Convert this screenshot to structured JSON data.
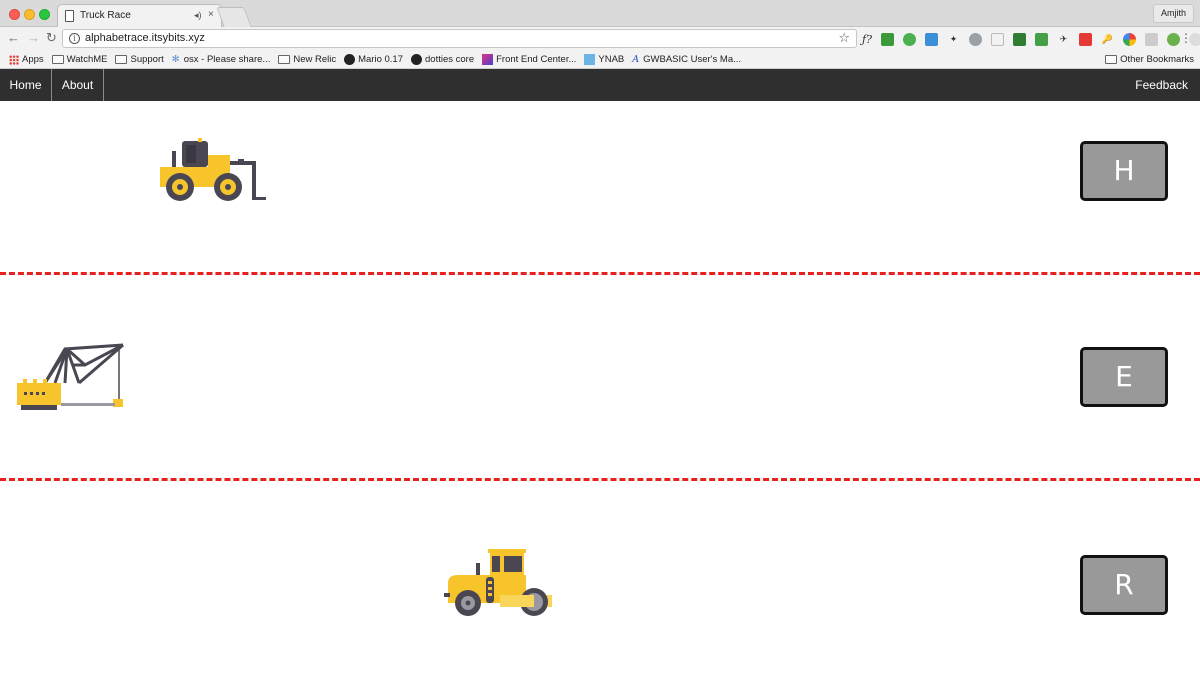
{
  "browser": {
    "tab_title": "Truck Race",
    "tab_close": "×",
    "tab_audio": "◂)",
    "profile_name": "Amjith",
    "url": "alphabetrace.itsybits.xyz",
    "back": "←",
    "forward": "→",
    "reload": "↻",
    "star": "☆",
    "menu": "⋮",
    "ext_text": "ƒ?",
    "bookmarks": [
      {
        "label": "Apps",
        "icon": "apps-grid-icon"
      },
      {
        "label": "WatchME",
        "icon": "folder-icon"
      },
      {
        "label": "Support",
        "icon": "folder-icon"
      },
      {
        "label": "osx - Please share...",
        "icon": "bookmark-icon"
      },
      {
        "label": "New Relic",
        "icon": "folder-icon"
      },
      {
        "label": "Mario 0.17",
        "icon": "github-icon"
      },
      {
        "label": "dotties core",
        "icon": "github-icon"
      },
      {
        "label": "Front End Center...",
        "icon": "bookmark-icon"
      },
      {
        "label": "YNAB",
        "icon": "ynab-icon"
      },
      {
        "label": "GWBASIC User's Ma...",
        "icon": "bookmark-icon"
      }
    ],
    "other_bookmarks": "Other Bookmarks"
  },
  "nav": {
    "home": "Home",
    "about": "About",
    "feedback": "Feedback"
  },
  "lanes": [
    {
      "key": "H",
      "vehicle": "forklift-loader-icon",
      "progress": 0.13
    },
    {
      "key": "E",
      "vehicle": "crane-icon",
      "progress": 0.0
    },
    {
      "key": "R",
      "vehicle": "road-roller-icon",
      "progress": 0.37
    }
  ],
  "colors": {
    "vehicle_yellow": "#f7c42c",
    "vehicle_dark": "#4a4752",
    "lane_divider": "#e8211f",
    "key_button": "#999999",
    "nav_bar": "#2f2f2f"
  }
}
